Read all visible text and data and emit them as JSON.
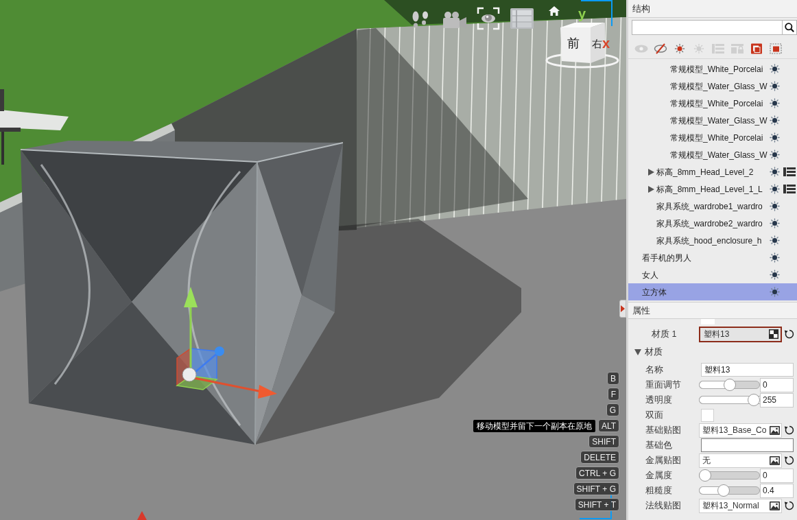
{
  "viewport": {
    "view_cube": {
      "front": "前",
      "right": "右",
      "y_axis": "y",
      "x_axis": "x"
    },
    "shortcuts": [
      {
        "label": "B"
      },
      {
        "label": "F"
      },
      {
        "label": "G"
      },
      {
        "label": "ALT",
        "tooltip": "移动模型并留下一个副本在原地"
      },
      {
        "label": "SHIFT"
      },
      {
        "label": "DELETE"
      },
      {
        "label": "CTRL + G"
      },
      {
        "label": "SHIFT + G"
      },
      {
        "label": "SHIFT + T"
      }
    ]
  },
  "structure": {
    "title": "结构",
    "toolbar": [
      {
        "disabled": true
      },
      {
        "disabled": false
      },
      {
        "disabled": false
      },
      {
        "disabled": true
      },
      {
        "disabled": true
      },
      {
        "disabled": true
      },
      {
        "disabled": false
      },
      {
        "disabled": false
      }
    ],
    "tree": [
      {
        "children": [
          {
            "children": [
              {
                "kind": "item",
                "label": "常规模型_White_Porcelai",
                "selected": false
              },
              {
                "kind": "item",
                "label": "常规模型_Water_Glass_W",
                "selected": false
              },
              {
                "kind": "item",
                "label": "常规模型_White_Porcelai",
                "selected": false
              },
              {
                "kind": "item",
                "label": "常规模型_Water_Glass_W",
                "selected": false
              },
              {
                "kind": "item",
                "label": "常规模型_White_Porcelai",
                "selected": false
              },
              {
                "kind": "item",
                "label": "常规模型_Water_Glass_W",
                "selected": false
              }
            ]
          },
          {
            "kind": "group",
            "label": "标高_8mm_Head_Level_2",
            "expanded": false,
            "selected": false
          },
          {
            "kind": "group",
            "label": "标高_8mm_Head_Level_1_L",
            "expanded": false,
            "selected": false
          },
          {
            "kind": "item",
            "label": "家具系统_wardrobe1_wardro",
            "selected": false
          },
          {
            "kind": "item",
            "label": "家具系统_wardrobe2_wardro",
            "selected": false
          },
          {
            "kind": "item",
            "label": "家具系统_hood_enclosure_h",
            "selected": false
          }
        ]
      },
      {
        "kind": "item",
        "label": "看手机的男人",
        "selected": false
      },
      {
        "kind": "item",
        "label": "女人",
        "selected": false
      },
      {
        "kind": "item",
        "label": "立方体",
        "selected": true
      }
    ]
  },
  "properties": {
    "title": "属性",
    "material_slot": {
      "label": "材质 1",
      "value": "塑料13",
      "selected": true
    },
    "section": {
      "label": "材质",
      "expanded": true
    },
    "rows": [
      {
        "kind": "text",
        "label": "名称",
        "value": "塑料13"
      },
      {
        "kind": "slider",
        "label": "重面调节",
        "level": 0.5,
        "value": "0"
      },
      {
        "kind": "slider",
        "label": "透明度",
        "level": 1,
        "value": "255"
      },
      {
        "kind": "checkbox",
        "label": "双面",
        "checked": false
      },
      {
        "kind": "texture",
        "label": "基础贴图",
        "value": "塑料13_Base_Co"
      },
      {
        "kind": "color",
        "label": "基础色",
        "color": "#ffffff"
      },
      {
        "kind": "texture",
        "label": "金属贴图",
        "value": "无"
      },
      {
        "kind": "slider",
        "label": "金属度",
        "level": 0,
        "value": "0"
      },
      {
        "kind": "slider",
        "label": "粗糙度",
        "level": 0.4,
        "value": "0.4"
      },
      {
        "kind": "texture",
        "label": "法线贴图",
        "value": "塑料13_Normal"
      }
    ]
  }
}
